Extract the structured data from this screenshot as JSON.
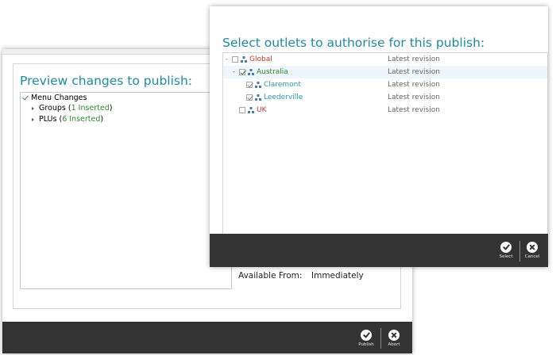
{
  "preview": {
    "title": "Preview changes to publish:",
    "tree": {
      "root": "Menu Changes",
      "items": [
        {
          "name": "Groups",
          "count": "1 Inserted"
        },
        {
          "name": "PLUs",
          "count": "6 Inserted"
        }
      ]
    },
    "available_from_label": "Available From:",
    "available_from_value": "Immediately",
    "footer": {
      "publish_label": "Publish",
      "abort_label": "Abort"
    }
  },
  "outlets": {
    "title": "Select outlets to authorise for this publish:",
    "rows": [
      {
        "name": "Global",
        "revision": "Latest revision",
        "checked": false,
        "color": "#c0392b"
      },
      {
        "name": "Australia",
        "revision": "Latest revision",
        "checked": true,
        "color": "#2e8b2e"
      },
      {
        "name": "Claremont",
        "revision": "Latest revision",
        "checked": true,
        "color": "#2a9aa8"
      },
      {
        "name": "Leederville",
        "revision": "Latest revision",
        "checked": true,
        "color": "#2a9aa8"
      },
      {
        "name": "UK",
        "revision": "Latest revision",
        "checked": false,
        "color": "#c0392b"
      }
    ],
    "footer": {
      "select_label": "Select",
      "cancel_label": "Cancel"
    }
  },
  "colors": {
    "accent": "#1e8aa3",
    "footer": "#333333",
    "count": "#2e8b2e"
  },
  "icons": {
    "check": "check-circle-icon",
    "close": "close-circle-icon",
    "hierarchy": "hierarchy-icon",
    "expand": "expand-arrow-icon"
  }
}
